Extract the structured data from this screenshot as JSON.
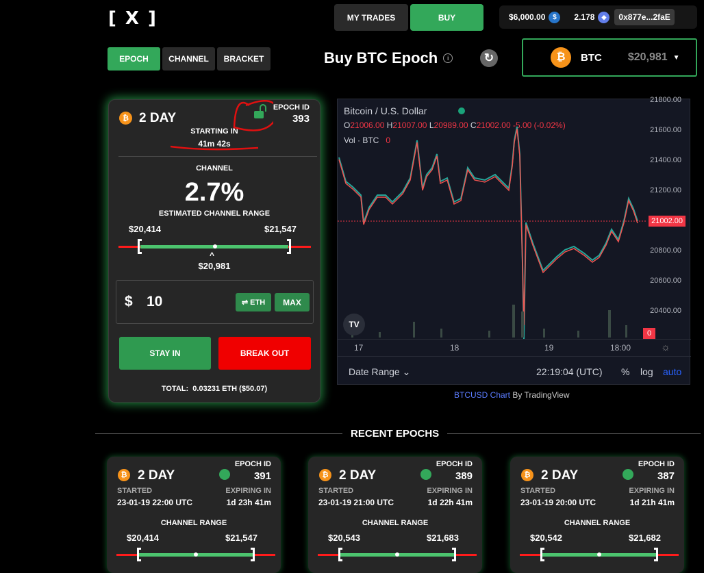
{
  "logo": "[ X ]",
  "nav": {
    "my_trades": "MY TRADES",
    "buy": "BUY"
  },
  "wallet": {
    "usdc_balance": "$6,000.00",
    "eth_balance": "2.178",
    "address": "0x877e...2faE",
    "usdc_icon": "$",
    "eth_icon": "◆"
  },
  "tabs": [
    "EPOCH",
    "CHANNEL",
    "BRACKET"
  ],
  "page_title": "Buy BTC Epoch",
  "asset_select": {
    "symbol": "BTC",
    "price": "$20,981",
    "icon": "₿"
  },
  "epoch_card": {
    "duration": "2 DAY",
    "epoch_id_label": "EPOCH ID",
    "epoch_id": "393",
    "starting_label": "STARTING IN",
    "starting_value": "41m 42s",
    "channel_label": "CHANNEL",
    "channel_pct": "2.7%",
    "range_label": "ESTIMATED CHANNEL RANGE",
    "range_low": "$20,414",
    "range_high": "$21,547",
    "current": "$20,981",
    "amount_prefix": "$",
    "amount": "10",
    "eth_toggle": "⇌ ETH",
    "max": "MAX",
    "stay_in": "STAY IN",
    "break_out": "BREAK OUT",
    "total_label": "TOTAL:",
    "total_value": "0.03231 ETH ($50.07)"
  },
  "chart": {
    "symbol": "Bitcoin / U.S. Dollar",
    "o_label": "O",
    "o": "21006.00",
    "h_label": "H",
    "h": "21007.00",
    "l_label": "L",
    "l": "20989.00",
    "c_label": "C",
    "c": "21002.00",
    "change": "-5.00 (-0.02%)",
    "vol_label": "Vol · BTC",
    "vol": "0",
    "y_ticks": [
      "21800.00",
      "21600.00",
      "21400.00",
      "21200.00",
      "21000.00",
      "20800.00",
      "20600.00",
      "20400.00"
    ],
    "price_tag": "21002.00",
    "vol_tag": "0",
    "x_ticks": [
      "17",
      "18",
      "19",
      "18:00"
    ],
    "date_range": "Date Range",
    "time": "22:19:04 (UTC)",
    "pct": "%",
    "log": "log",
    "auto": "auto",
    "tv_logo": "TV",
    "attribution_link": "BTCUSD Chart",
    "attribution_text": " By TradingView"
  },
  "recent_title": "RECENT EPOCHS",
  "recent": [
    {
      "duration": "2 DAY",
      "epoch_id_label": "EPOCH ID",
      "epoch_id": "391",
      "started_label": "STARTED",
      "started": "23-01-19 22:00 UTC",
      "expiring_label": "EXPIRING IN",
      "expiring": "1d 23h 41m",
      "range_label": "CHANNEL RANGE",
      "low": "$20,414",
      "high": "$21,547"
    },
    {
      "duration": "2 DAY",
      "epoch_id_label": "EPOCH ID",
      "epoch_id": "389",
      "started_label": "STARTED",
      "started": "23-01-19 21:00 UTC",
      "expiring_label": "EXPIRING IN",
      "expiring": "1d 22h 41m",
      "range_label": "CHANNEL RANGE",
      "low": "$20,543",
      "high": "$21,683"
    },
    {
      "duration": "2 DAY",
      "epoch_id_label": "EPOCH ID",
      "epoch_id": "387",
      "started_label": "STARTED",
      "started": "23-01-19 20:00 UTC",
      "expiring_label": "EXPIRING IN",
      "expiring": "1d 21h 41m",
      "range_label": "CHANNEL RANGE",
      "low": "$20,542",
      "high": "$21,682"
    }
  ],
  "colors": {
    "accent": "#33a85a",
    "danger": "#ff1b1b",
    "btc": "#f7931a",
    "usdc": "#2775ca",
    "eth": "#627eea"
  }
}
